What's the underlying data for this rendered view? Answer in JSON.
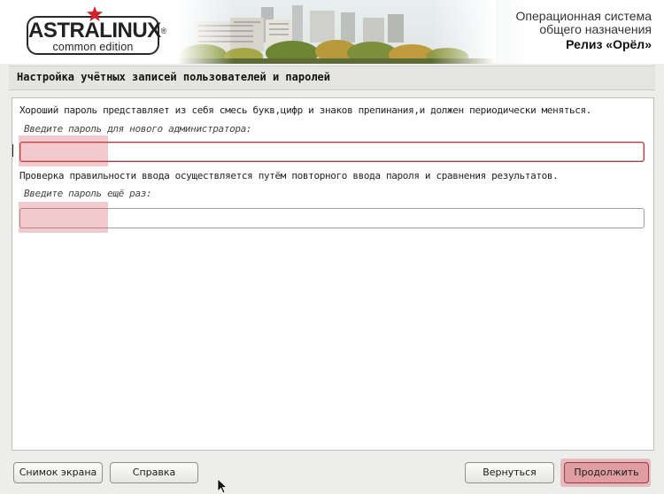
{
  "header": {
    "logo_main": "ASTRALINUX",
    "logo_sub": "common edition",
    "logo_registered": "®",
    "release_line1": "Операционная система",
    "release_line2": "общего назначения",
    "release_line3": "Релиз «Орёл»"
  },
  "page": {
    "title": "Настройка учётных записей пользователей и паролей"
  },
  "form": {
    "intro_text": "Хороший пароль представляет из себя смесь букв,цифр и знаков препинания,и должен периодически меняться.",
    "password_label": "Введите пароль для нового администратора:",
    "password_value": "",
    "verify_text": "Проверка правильности ввода осуществляется путём повторного ввода пароля и сравнения результатов.",
    "confirm_label": "Введите пароль ещё раз:",
    "confirm_value": ""
  },
  "buttons": {
    "screenshot": "Снимок экрана",
    "help": "Справка",
    "back": "Вернуться",
    "continue": "Продолжить"
  },
  "colors": {
    "highlight": "#d75a64",
    "focus_border": "#b3363e",
    "logo_star": "#d4202a"
  }
}
